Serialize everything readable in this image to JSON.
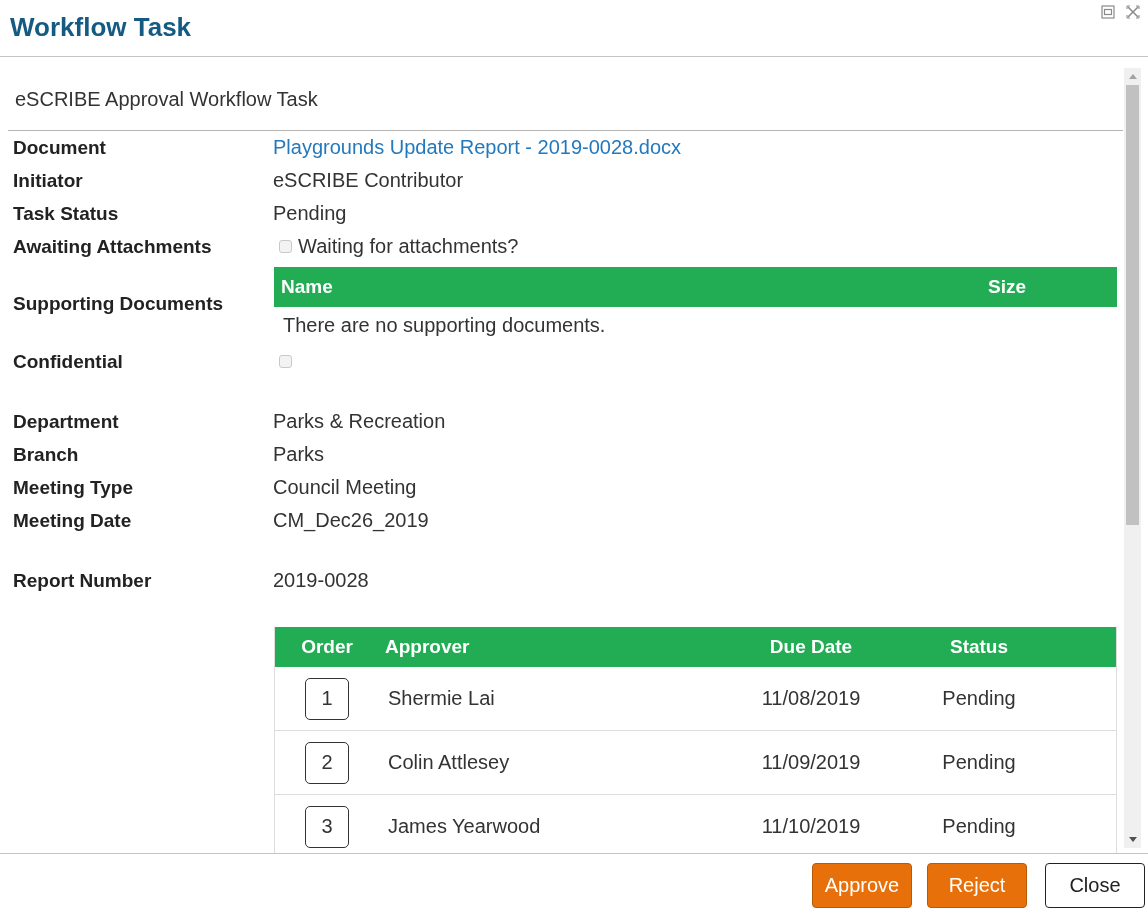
{
  "window": {
    "title": "Workflow Task"
  },
  "form": {
    "title": "eSCRIBE Approval Workflow Task"
  },
  "sections": [
    {
      "fields": [
        {
          "kind": "link",
          "label": "Document",
          "value": "Playgrounds Update Report - 2019-0028.docx"
        },
        {
          "kind": "text",
          "label": "Initiator",
          "value": "eSCRIBE Contributor"
        },
        {
          "kind": "text",
          "label": "Task Status",
          "value": "Pending"
        },
        {
          "kind": "checkbox",
          "label": "Awaiting Attachments",
          "checked": false,
          "caption": "Waiting for attachments?"
        },
        {
          "kind": "table",
          "label": "Supporting Documents",
          "columns": [
            "Name",
            "Size"
          ],
          "empty_message": "There are no supporting documents."
        },
        {
          "kind": "checkbox",
          "label": "Confidential",
          "checked": false
        }
      ]
    },
    {
      "fields": [
        {
          "kind": "text",
          "label": "Department",
          "value": "Parks & Recreation"
        },
        {
          "kind": "text",
          "label": "Branch",
          "value": "Parks"
        },
        {
          "kind": "text",
          "label": "Meeting Type",
          "value": "Council Meeting"
        },
        {
          "kind": "text",
          "label": "Meeting Date",
          "value": "CM_Dec26_2019"
        }
      ]
    },
    {
      "fields": [
        {
          "kind": "text",
          "label": "Report Number",
          "value": "2019-0028"
        }
      ]
    }
  ],
  "approvers": {
    "columns": [
      "Order",
      "Approver",
      "Due Date",
      "Status"
    ],
    "rows": [
      {
        "order": "1",
        "approver": "Shermie Lai",
        "due_date": "11/08/2019",
        "status": "Pending"
      },
      {
        "order": "2",
        "approver": "Colin Attlesey",
        "due_date": "11/09/2019",
        "status": "Pending"
      },
      {
        "order": "3",
        "approver": "James Yearwood",
        "due_date": "11/10/2019",
        "status": "Pending"
      }
    ]
  },
  "buttons": [
    {
      "kind": "primary",
      "label": "Approve"
    },
    {
      "kind": "primary",
      "label": "Reject"
    },
    {
      "kind": "secondary",
      "label": "Close"
    }
  ]
}
